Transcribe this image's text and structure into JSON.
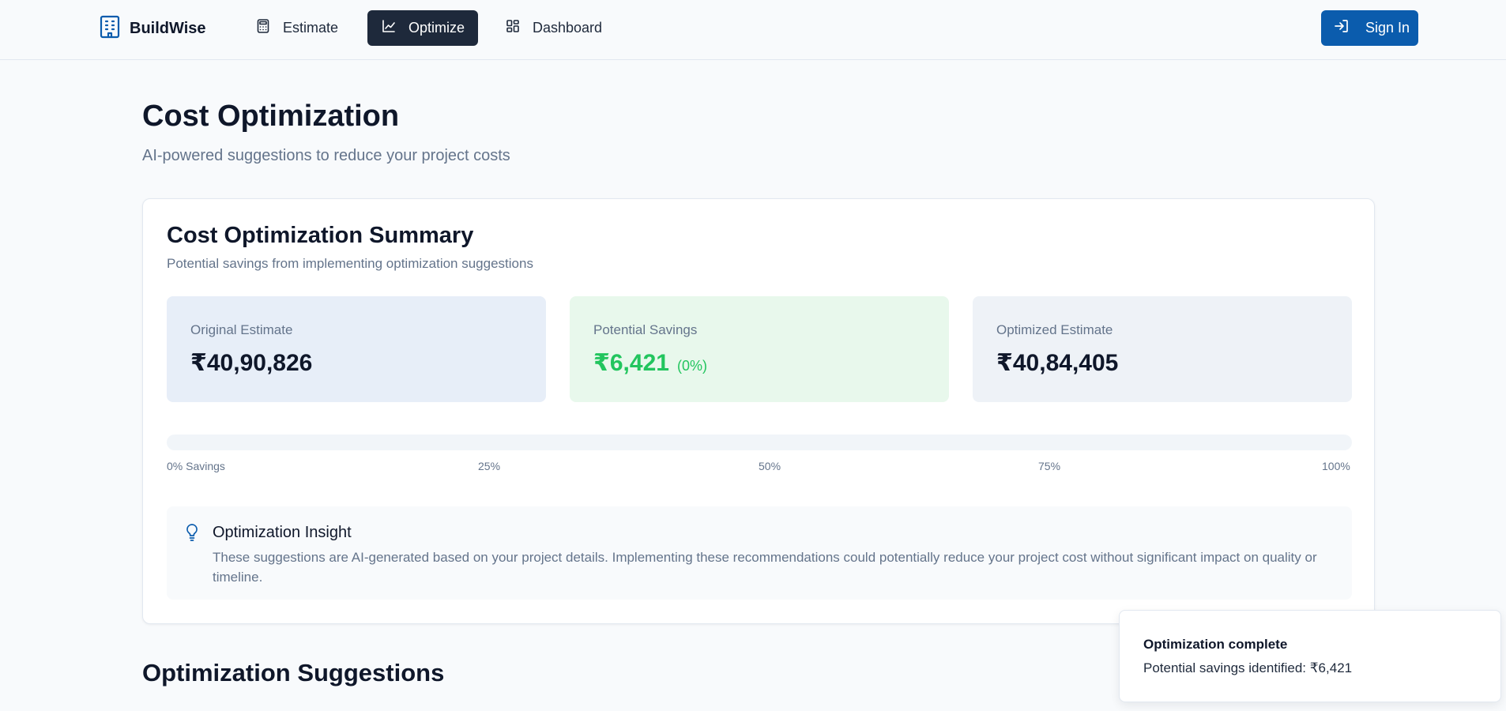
{
  "navbar": {
    "brand": "BuildWise",
    "brand_icon": "building-icon",
    "items": [
      {
        "label": "Estimate",
        "icon": "calculator-icon",
        "active": false
      },
      {
        "label": "Optimize",
        "icon": "line-chart-icon",
        "active": true
      },
      {
        "label": "Dashboard",
        "icon": "dashboard-grid-icon",
        "active": false
      }
    ],
    "signin_label": "Sign In",
    "signin_icon": "log-in-icon"
  },
  "header": {
    "title": "Cost Optimization",
    "subtitle": "AI-powered suggestions to reduce your project costs"
  },
  "summary": {
    "title": "Cost Optimization Summary",
    "description": "Potential savings from implementing optimization suggestions",
    "stats": {
      "original": {
        "label": "Original Estimate",
        "value": "₹40,90,826"
      },
      "savings": {
        "label": "Potential Savings",
        "value": "₹6,421",
        "percent": "(0%)"
      },
      "optimized": {
        "label": "Optimized Estimate",
        "value": "₹40,84,405"
      }
    },
    "progress": {
      "fraction": 0.0,
      "ticks": [
        "0% Savings",
        "25%",
        "50%",
        "75%",
        "100%"
      ]
    },
    "insight": {
      "icon": "lightbulb-icon",
      "title": "Optimization Insight",
      "text": "These suggestions are AI-generated based on your project details. Implementing these recommendations could potentially reduce your project cost without significant impact on quality or timeline."
    }
  },
  "suggestions": {
    "title": "Optimization Suggestions"
  },
  "toast": {
    "title": "Optimization complete",
    "message": "Potential savings identified: ₹6,421"
  },
  "colors": {
    "accent": "#0b5cad",
    "active_nav": "#1e293b",
    "savings_green": "#22c55e",
    "text_muted": "#64748b"
  }
}
